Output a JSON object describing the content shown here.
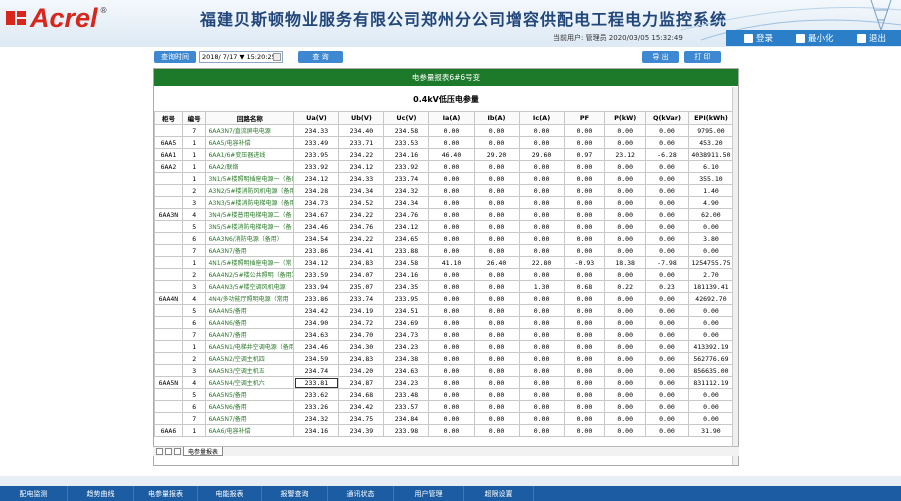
{
  "header": {
    "logo_text": "Acrel",
    "logo_reg": "®",
    "title": "福建贝斯顿物业服务有限公司郑州分公司增容供配电工程电力监控系统",
    "user_info": "当前用户: 管理员    2020/03/05  15:32:49",
    "btn_login": "登录",
    "btn_minimize": "最小化",
    "btn_exit": "退出"
  },
  "toolbar": {
    "query_time_label": "查询时间",
    "date_value": "2018/ 7/17 ▼ 15:20:25",
    "query_button": "查 询",
    "export_button": "导 出",
    "print_button": "打 印"
  },
  "report": {
    "title": "电参量报表6#6号变",
    "subtitle": "0.4kV低压电参量",
    "columns": [
      "柜号",
      "编号",
      "回路名称",
      "Ua(V)",
      "Ub(V)",
      "Uc(V)",
      "Ia(A)",
      "Ib(A)",
      "Ic(A)",
      "PF",
      "P(kW)",
      "Q(kVar)",
      "EPI(kWh)"
    ],
    "rows": [
      {
        "cab": "",
        "no": "7",
        "name": "6AA3N7/直流屏电电源",
        "ua": "234.33",
        "ub": "234.40",
        "uc": "234.58",
        "ia": "0.00",
        "ib": "0.00",
        "ic": "0.00",
        "pf": "0.00",
        "p": "0.00",
        "q": "0.00",
        "epi": "9795.00"
      },
      {
        "cab": "6AA5",
        "no": "1",
        "name": "6AA5/电容补偿",
        "ua": "233.49",
        "ub": "233.71",
        "uc": "233.53",
        "ia": "0.00",
        "ib": "0.00",
        "ic": "0.00",
        "pf": "0.00",
        "p": "0.00",
        "q": "0.00",
        "epi": "453.20"
      },
      {
        "cab": "6AA1",
        "no": "1",
        "name": "6AA1/6#变压器进线",
        "ua": "233.95",
        "ub": "234.22",
        "uc": "234.16",
        "ia": "46.40",
        "ib": "29.20",
        "ic": "29.60",
        "pf": "0.97",
        "p": "23.12",
        "q": "-6.28",
        "epi": "4038911.50"
      },
      {
        "cab": "6AA2",
        "no": "1",
        "name": "6AA2/联络",
        "ua": "233.92",
        "ub": "234.12",
        "uc": "233.92",
        "ia": "0.00",
        "ib": "0.00",
        "ic": "0.00",
        "pf": "0.00",
        "p": "0.00",
        "q": "0.00",
        "epi": "6.10"
      },
      {
        "cab": "",
        "no": "1",
        "name": "3N1/5#楼照明插座电源一（备用",
        "ua": "234.12",
        "ub": "234.33",
        "uc": "233.74",
        "ia": "0.00",
        "ib": "0.00",
        "ic": "0.00",
        "pf": "0.00",
        "p": "0.00",
        "q": "0.00",
        "epi": "355.10"
      },
      {
        "cab": "",
        "no": "2",
        "name": "A3N2/5#楼消防风机电源（备用",
        "ua": "234.28",
        "ub": "234.34",
        "uc": "234.32",
        "ia": "0.00",
        "ib": "0.00",
        "ic": "0.00",
        "pf": "0.00",
        "p": "0.00",
        "q": "0.00",
        "epi": "1.40"
      },
      {
        "cab": "",
        "no": "3",
        "name": "A3N3/5#楼消防电梯电源（备用",
        "ua": "234.73",
        "ub": "234.52",
        "uc": "234.34",
        "ia": "0.00",
        "ib": "0.00",
        "ic": "0.00",
        "pf": "0.00",
        "p": "0.00",
        "q": "0.00",
        "epi": "4.90"
      },
      {
        "cab": "6AA3N",
        "no": "4",
        "name": "3N4/5#楼普用电梯电源二（备",
        "ua": "234.67",
        "ub": "234.22",
        "uc": "234.76",
        "ia": "0.00",
        "ib": "0.00",
        "ic": "0.00",
        "pf": "0.00",
        "p": "0.00",
        "q": "0.00",
        "epi": "62.00"
      },
      {
        "cab": "",
        "no": "5",
        "name": "3N5/5#楼消防电梯电源一（备",
        "ua": "234.46",
        "ub": "234.76",
        "uc": "234.12",
        "ia": "0.00",
        "ib": "0.00",
        "ic": "0.00",
        "pf": "0.00",
        "p": "0.00",
        "q": "0.00",
        "epi": "0.00"
      },
      {
        "cab": "",
        "no": "6",
        "name": "6AA3N6/消防电源（备用）",
        "ua": "234.54",
        "ub": "234.22",
        "uc": "234.65",
        "ia": "0.00",
        "ib": "0.00",
        "ic": "0.00",
        "pf": "0.00",
        "p": "0.00",
        "q": "0.00",
        "epi": "3.80"
      },
      {
        "cab": "",
        "no": "7",
        "name": "6AA3N7/备用",
        "ua": "233.86",
        "ub": "234.41",
        "uc": "233.88",
        "ia": "0.00",
        "ib": "0.00",
        "ic": "0.00",
        "pf": "0.00",
        "p": "0.00",
        "q": "0.00",
        "epi": "0.00"
      },
      {
        "cab": "",
        "no": "1",
        "name": "4N1/5#楼照明插座电源一（常",
        "ua": "234.12",
        "ub": "234.83",
        "uc": "234.58",
        "ia": "41.10",
        "ib": "26.40",
        "ic": "22.80",
        "pf": "-0.93",
        "p": "18.38",
        "q": "-7.98",
        "epi": "1254755.75"
      },
      {
        "cab": "",
        "no": "2",
        "name": "6AA4N2/5#楼公共照明（备用）",
        "ua": "233.59",
        "ub": "234.07",
        "uc": "234.16",
        "ia": "0.00",
        "ib": "0.00",
        "ic": "0.00",
        "pf": "0.00",
        "p": "0.00",
        "q": "0.00",
        "epi": "2.70"
      },
      {
        "cab": "",
        "no": "3",
        "name": "6AA4N3/5#楼空调风机电源",
        "ua": "233.94",
        "ub": "235.07",
        "uc": "234.35",
        "ia": "0.00",
        "ib": "0.00",
        "ic": "1.30",
        "pf": "0.68",
        "p": "0.22",
        "q": "0.23",
        "epi": "181139.41"
      },
      {
        "cab": "6AA4N",
        "no": "4",
        "name": "4N4/多功能厅照明电源（常用",
        "ua": "233.86",
        "ub": "233.74",
        "uc": "233.95",
        "ia": "0.00",
        "ib": "0.00",
        "ic": "0.00",
        "pf": "0.00",
        "p": "0.00",
        "q": "0.00",
        "epi": "42692.70"
      },
      {
        "cab": "",
        "no": "5",
        "name": "6AA4N5/备用",
        "ua": "234.42",
        "ub": "234.19",
        "uc": "234.51",
        "ia": "0.00",
        "ib": "0.00",
        "ic": "0.00",
        "pf": "0.00",
        "p": "0.00",
        "q": "0.00",
        "epi": "0.00"
      },
      {
        "cab": "",
        "no": "6",
        "name": "6AA4N6/备用",
        "ua": "234.90",
        "ub": "234.72",
        "uc": "234.69",
        "ia": "0.00",
        "ib": "0.00",
        "ic": "0.00",
        "pf": "0.00",
        "p": "0.00",
        "q": "0.00",
        "epi": "0.00"
      },
      {
        "cab": "",
        "no": "7",
        "name": "6AA4N7/备用",
        "ua": "234.63",
        "ub": "234.70",
        "uc": "234.73",
        "ia": "0.00",
        "ib": "0.00",
        "ic": "0.00",
        "pf": "0.00",
        "p": "0.00",
        "q": "0.00",
        "epi": "0.00"
      },
      {
        "cab": "",
        "no": "1",
        "name": "6AA5N1/电梯井空调电源（备用",
        "ua": "234.46",
        "ub": "234.30",
        "uc": "234.23",
        "ia": "0.00",
        "ib": "0.00",
        "ic": "0.00",
        "pf": "0.00",
        "p": "0.00",
        "q": "0.00",
        "epi": "413392.19"
      },
      {
        "cab": "",
        "no": "2",
        "name": "6AA5N2/空调主机四",
        "ua": "234.59",
        "ub": "234.83",
        "uc": "234.38",
        "ia": "0.00",
        "ib": "0.00",
        "ic": "0.00",
        "pf": "0.00",
        "p": "0.00",
        "q": "0.00",
        "epi": "562776.69"
      },
      {
        "cab": "",
        "no": "3",
        "name": "6AA5N3/空调主机五",
        "ua": "234.74",
        "ub": "234.20",
        "uc": "234.63",
        "ia": "0.00",
        "ib": "0.00",
        "ic": "0.00",
        "pf": "0.00",
        "p": "0.00",
        "q": "0.00",
        "epi": "856635.00"
      },
      {
        "cab": "6AA5N",
        "no": "4",
        "name": "6AA5N4/空调主机六",
        "ua": "233.81",
        "ub": "234.87",
        "uc": "234.23",
        "ia": "0.00",
        "ib": "0.00",
        "ic": "0.00",
        "pf": "0.00",
        "p": "0.00",
        "q": "0.00",
        "epi": "831112.19"
      },
      {
        "cab": "",
        "no": "5",
        "name": "6AA5N5/备用",
        "ua": "233.62",
        "ub": "234.68",
        "uc": "233.48",
        "ia": "0.00",
        "ib": "0.00",
        "ic": "0.00",
        "pf": "0.00",
        "p": "0.00",
        "q": "0.00",
        "epi": "0.00"
      },
      {
        "cab": "",
        "no": "6",
        "name": "6AA5N6/备用",
        "ua": "233.26",
        "ub": "234.42",
        "uc": "233.57",
        "ia": "0.00",
        "ib": "0.00",
        "ic": "0.00",
        "pf": "0.00",
        "p": "0.00",
        "q": "0.00",
        "epi": "0.00"
      },
      {
        "cab": "",
        "no": "7",
        "name": "6AA5N7/备用",
        "ua": "234.32",
        "ub": "234.75",
        "uc": "234.84",
        "ia": "0.00",
        "ib": "0.00",
        "ic": "0.00",
        "pf": "0.00",
        "p": "0.00",
        "q": "0.00",
        "epi": "0.00"
      },
      {
        "cab": "6AA6",
        "no": "1",
        "name": "6AA6/电容补偿",
        "ua": "234.16",
        "ub": "234.39",
        "uc": "233.98",
        "ia": "0.00",
        "ib": "0.00",
        "ic": "0.00",
        "pf": "0.00",
        "p": "0.00",
        "q": "0.00",
        "epi": "31.90"
      }
    ]
  },
  "sheet_tab": "电参量报表",
  "bottom_nav": [
    "配电监测",
    "趋势曲线",
    "电参量报表",
    "电能报表",
    "报警查询",
    "通讯状态",
    "用户管理",
    "超限设置"
  ],
  "colors": {
    "brand_red": "#d8261c",
    "title_blue": "#21467a",
    "accent_blue": "#3d88d0",
    "report_green": "#1d7a2a",
    "nav_blue": "#1b5ca3"
  }
}
